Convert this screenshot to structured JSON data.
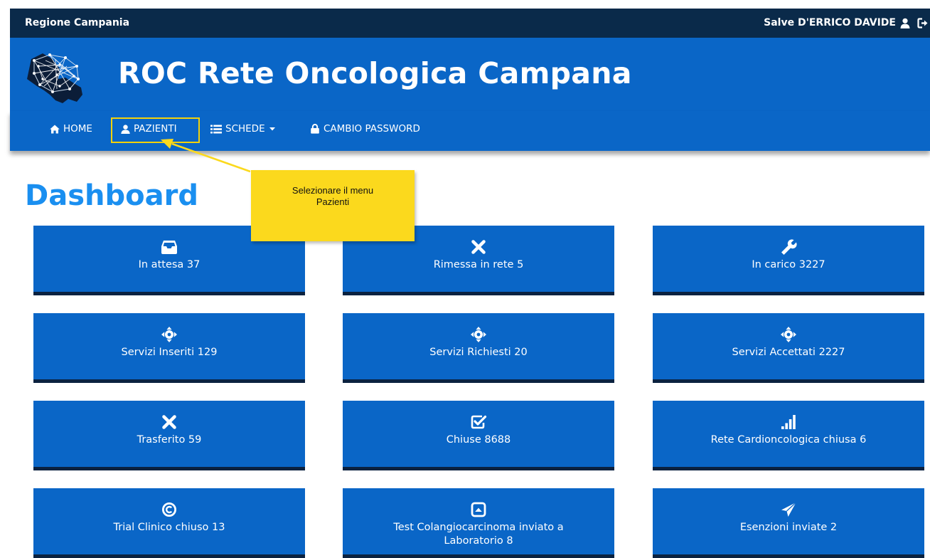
{
  "topbar": {
    "region": "Regione Campania",
    "greeting": "Salve D'ERRICO DAVIDE"
  },
  "header": {
    "title": "ROC Rete Oncologica Campana"
  },
  "nav": {
    "items": [
      {
        "label": "HOME",
        "icon": "home-icon"
      },
      {
        "label": "PAZIENTI",
        "icon": "user-icon",
        "highlighted": true
      },
      {
        "label": "SCHEDE",
        "icon": "list-icon",
        "dropdown": true
      },
      {
        "label": "CAMBIO PASSWORD",
        "icon": "lock-icon"
      }
    ]
  },
  "page": {
    "title": "Dashboard"
  },
  "callout": {
    "text": "Selezionare il menu Pazienti"
  },
  "tiles": [
    {
      "label": "In attesa 37",
      "icon": "inbox-icon"
    },
    {
      "label": "Rimessa in rete 5",
      "icon": "close-icon"
    },
    {
      "label": "In carico 3227",
      "icon": "wrench-icon"
    },
    {
      "label": "Servizi Inseriti 129",
      "icon": "move-icon"
    },
    {
      "label": "Servizi Richiesti 20",
      "icon": "move-icon"
    },
    {
      "label": "Servizi Accettati 2227",
      "icon": "move-icon"
    },
    {
      "label": "Trasferito 59",
      "icon": "close-icon"
    },
    {
      "label": "Chiuse 8688",
      "icon": "check-square-icon"
    },
    {
      "label": "Rete Cardioncologica chiusa 6",
      "icon": "signal-icon"
    },
    {
      "label": "Trial Clinico chiuso 13",
      "icon": "copyright-icon"
    },
    {
      "label": "Test Colangiocarcinoma inviato a Laboratorio 8",
      "icon": "collapse-up-icon"
    },
    {
      "label": "Esenzioni inviate 2",
      "icon": "send-icon"
    }
  ],
  "colors": {
    "brand_blue": "#0a66c7",
    "top_strip": "#0a2a4a",
    "title_blue": "#1a8ff0",
    "callout_yellow": "#fbd91d"
  }
}
